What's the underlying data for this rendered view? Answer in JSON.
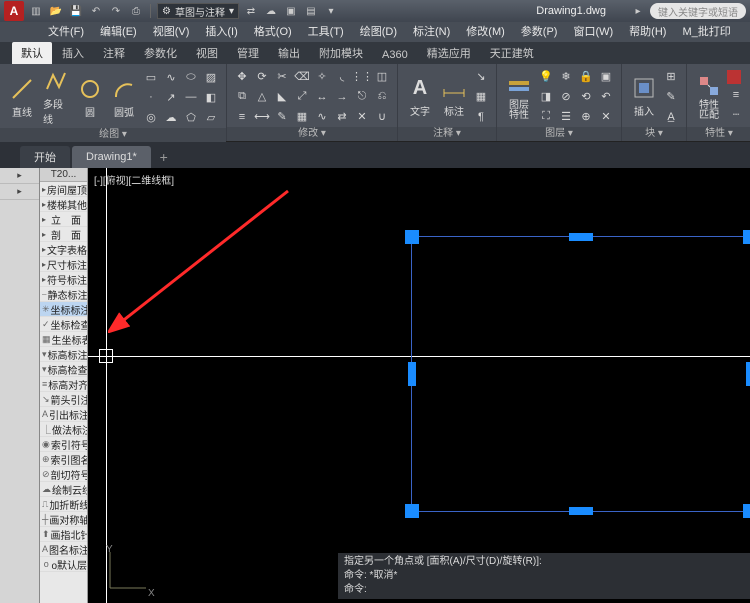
{
  "title": {
    "doc": "Drawing1.dwg",
    "search_placeholder": "键入关键字或短语"
  },
  "qat": {
    "workspace": "草图与注释"
  },
  "menubar": [
    "文件(F)",
    "编辑(E)",
    "视图(V)",
    "插入(I)",
    "格式(O)",
    "工具(T)",
    "绘图(D)",
    "标注(N)",
    "修改(M)",
    "参数(P)",
    "窗口(W)",
    "帮助(H)",
    "M_批打印"
  ],
  "ribbon_tabs": [
    "默认",
    "插入",
    "注释",
    "参数化",
    "视图",
    "管理",
    "输出",
    "附加模块",
    "A360",
    "精选应用",
    "天正建筑"
  ],
  "ribbon_panels": {
    "draw": "绘图 ▾",
    "modify": "修改 ▾",
    "annot": "注释 ▾",
    "layer": "图层 ▾",
    "block": "块 ▾",
    "props": "特性 ▾"
  },
  "big_buttons": {
    "line": "直线",
    "polyline": "多段线",
    "circle": "圆",
    "arc": "圆弧",
    "text": "文字",
    "dim": "标注",
    "layerprops": "图层\n特性",
    "insert": "插入",
    "props": "特性\n匹配"
  },
  "doc_tabs": {
    "start": "开始",
    "d1": "Drawing1*"
  },
  "viewport_label": "[-][俯视][二维线框]",
  "palette": {
    "head": "T20...",
    "items": [
      {
        "t": "房间屋顶",
        "a": true
      },
      {
        "t": "楼梯其他",
        "a": true
      },
      {
        "t": "立　面",
        "a": true
      },
      {
        "t": "剖　面",
        "a": true
      },
      {
        "t": "文字表格",
        "a": true
      },
      {
        "t": "尺寸标注",
        "a": true
      },
      {
        "t": "符号标注",
        "a": true
      },
      {
        "t": "静态标注",
        "i": "⎯"
      },
      {
        "t": "坐标标注",
        "i": "✳",
        "hl": true
      },
      {
        "t": "坐标检查",
        "i": "✓"
      },
      {
        "t": "生坐标表",
        "i": "▦"
      },
      {
        "t": "标高标注",
        "i": "▾"
      },
      {
        "t": "标高检查",
        "i": "▾"
      },
      {
        "t": "标高对齐",
        "i": "≡"
      },
      {
        "t": "箭头引注",
        "i": "↘"
      },
      {
        "t": "引出标注",
        "i": "A"
      },
      {
        "t": "做法标注",
        "i": "⎿"
      },
      {
        "t": "索引符号",
        "i": "◉"
      },
      {
        "t": "索引图名",
        "i": "⊕"
      },
      {
        "t": "剖切符号",
        "i": "⊘"
      },
      {
        "t": "绘制云线",
        "i": "☁"
      },
      {
        "t": "加折断线",
        "i": "⎍"
      },
      {
        "t": "画对称轴",
        "i": "┼"
      },
      {
        "t": "画指北针",
        "i": "⬆"
      },
      {
        "t": "图名标注",
        "i": "A"
      },
      {
        "t": "o默认层",
        "i": "o"
      }
    ]
  },
  "cmdline": {
    "l1": "指定另一个角点或 [面积(A)/尺寸(D)/旋转(R)]:",
    "l2": "命令: *取消*",
    "l3": "命令:"
  },
  "ucs": {
    "x": "X",
    "y": "Y"
  }
}
